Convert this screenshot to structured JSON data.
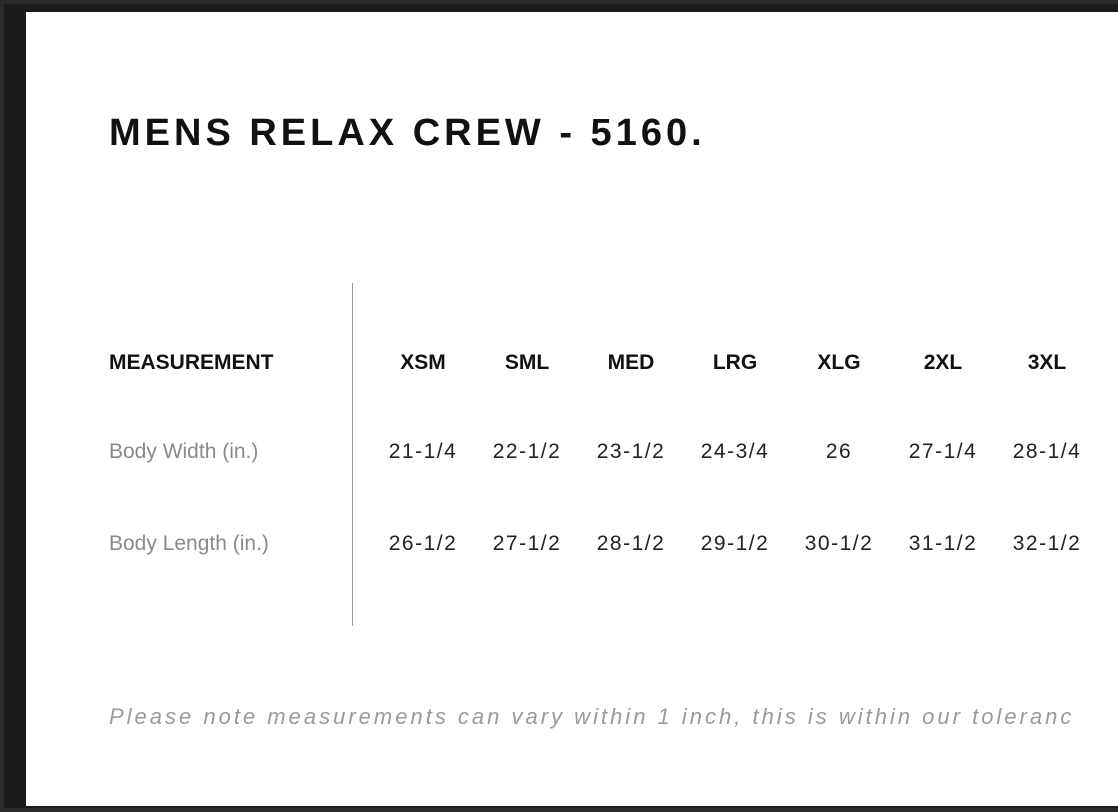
{
  "title": "MENS RELAX CREW - 5160.",
  "table": {
    "header_label": "MEASUREMENT",
    "sizes": [
      "XSM",
      "SML",
      "MED",
      "LRG",
      "XLG",
      "2XL",
      "3XL"
    ],
    "rows": [
      {
        "label": "Body Width (in.)",
        "values": [
          "21-1/4",
          "22-1/2",
          "23-1/2",
          "24-3/4",
          "26",
          "27-1/4",
          "28-1/4"
        ]
      },
      {
        "label": "Body Length (in.)",
        "values": [
          "26-1/2",
          "27-1/2",
          "28-1/2",
          "29-1/2",
          "30-1/2",
          "31-1/2",
          "32-1/2"
        ]
      }
    ]
  },
  "note": "Please note measurements can vary within 1 inch, this is within our toleranc"
}
